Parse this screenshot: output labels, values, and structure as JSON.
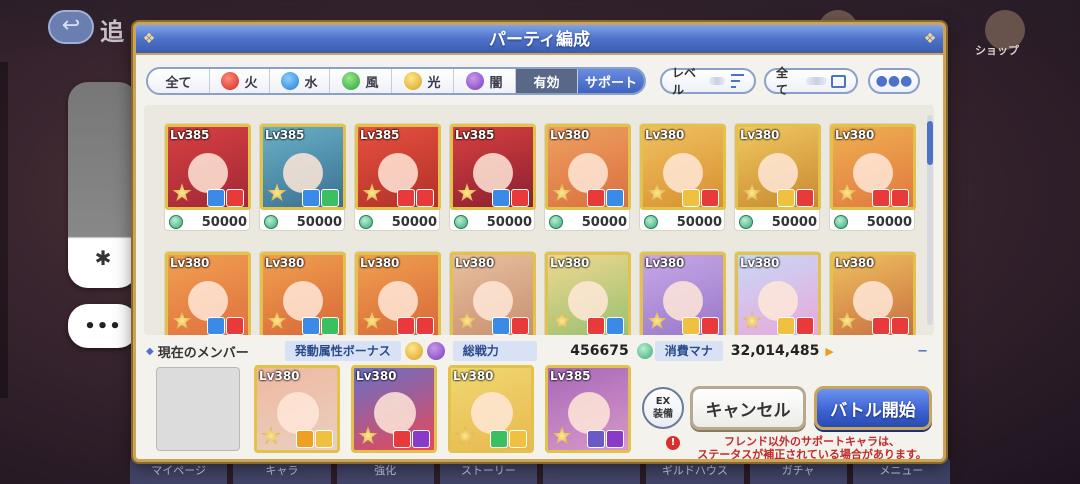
{
  "background": {
    "title": "追",
    "shop_label": "ショップ",
    "bottom_nav": [
      "マイページ",
      "キャラ",
      "強化",
      "ストーリー",
      "",
      "ギルドハウス",
      "ガチャ",
      "メニュー"
    ]
  },
  "modal": {
    "title": "パーティ編成",
    "filters": {
      "tabs": [
        {
          "label": "全て",
          "icon": ""
        },
        {
          "label": "火",
          "icon": "fire"
        },
        {
          "label": "水",
          "icon": "water"
        },
        {
          "label": "風",
          "icon": "wind"
        },
        {
          "label": "光",
          "icon": "light"
        },
        {
          "label": "闇",
          "icon": "dark"
        },
        {
          "label": "有効",
          "icon": ""
        },
        {
          "label": "サポート",
          "icon": ""
        }
      ],
      "sort_label": "レベル",
      "type_label": "全て"
    },
    "characters": [
      {
        "lv": "Lv385",
        "power": "50000",
        "colors": [
          "#d84040",
          "#a02838"
        ]
      },
      {
        "lv": "Lv385",
        "power": "50000",
        "colors": [
          "#6ab0c8",
          "#3a7090"
        ]
      },
      {
        "lv": "Lv385",
        "power": "50000",
        "colors": [
          "#e85040",
          "#b03028"
        ]
      },
      {
        "lv": "Lv385",
        "power": "50000",
        "colors": [
          "#d84040",
          "#8a2030"
        ]
      },
      {
        "lv": "Lv380",
        "power": "50000",
        "colors": [
          "#f0a060",
          "#d87040"
        ]
      },
      {
        "lv": "Lv380",
        "power": "50000",
        "colors": [
          "#f0c060",
          "#d89030"
        ]
      },
      {
        "lv": "Lv380",
        "power": "50000",
        "colors": [
          "#f0c860",
          "#c88830"
        ]
      },
      {
        "lv": "Lv380",
        "power": "50000",
        "colors": [
          "#f0b050",
          "#e07840"
        ]
      },
      {
        "lv": "Lv380",
        "power": "",
        "colors": [
          "#f0a050",
          "#e07040"
        ]
      },
      {
        "lv": "Lv380",
        "power": "",
        "colors": [
          "#f0a050",
          "#d86838"
        ]
      },
      {
        "lv": "Lv380",
        "power": "",
        "colors": [
          "#f0a050",
          "#d86838"
        ]
      },
      {
        "lv": "Lv380",
        "power": "",
        "colors": [
          "#e8c0a0",
          "#c89070"
        ]
      },
      {
        "lv": "Lv380",
        "power": "",
        "colors": [
          "#f0d890",
          "#98c070"
        ]
      },
      {
        "lv": "Lv380",
        "power": "",
        "colors": [
          "#c8a8e8",
          "#9878c8"
        ]
      },
      {
        "lv": "Lv380",
        "power": "",
        "colors": [
          "#c8d8f8",
          "#e8a8d8"
        ]
      },
      {
        "lv": "Lv380",
        "power": "",
        "colors": [
          "#f0c060",
          "#c87040"
        ]
      }
    ],
    "party": {
      "label": "現在のメンバー",
      "bonus_label": "発動属性ボーナス",
      "power_label": "総戦力",
      "power_value": "456675",
      "mana_label": "消費マナ",
      "mana_value": "32,014,485",
      "members": [
        {
          "lv": "Lv380",
          "colors": [
            "#f0b8a0",
            "#e8d0c0"
          ]
        },
        {
          "lv": "Lv380",
          "colors": [
            "#6870c8",
            "#e84858"
          ]
        },
        {
          "lv": "Lv380",
          "colors": [
            "#f0d870",
            "#e8b850"
          ]
        },
        {
          "lv": "Lv385",
          "colors": [
            "#a868b8",
            "#d898c8"
          ]
        }
      ]
    },
    "buttons": {
      "ex_line1": "EX",
      "ex_line2": "装備",
      "cancel": "キャンセル",
      "battle": "バトル開始"
    },
    "notice": [
      "フレンド以外のサポートキャラは、",
      "ステータスが補正されている場合があります。"
    ]
  },
  "colors": {
    "accent": "#4e72c8",
    "gold": "#c9a45a",
    "warning": "#c02a2a"
  }
}
